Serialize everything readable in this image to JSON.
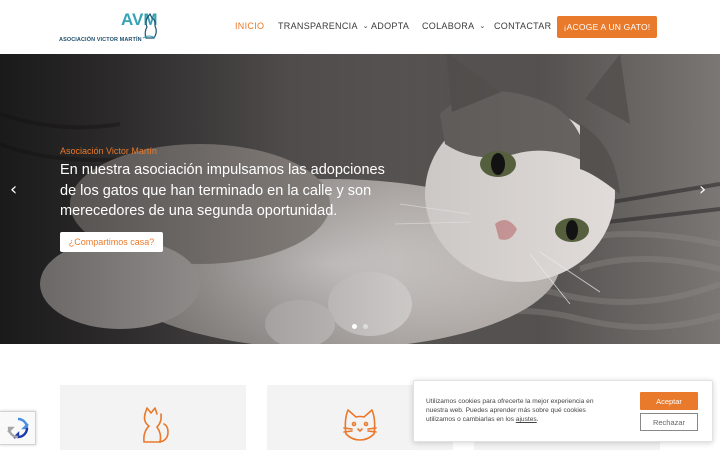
{
  "brand": {
    "logo_letters": "AVM",
    "logo_text": "ASOCIACIÓN VICTOR MARTÍN",
    "colors": {
      "accent": "#e9792b",
      "logo_blue": "#1f4e6b",
      "logo_teal": "#35a3b5"
    }
  },
  "nav": {
    "items": [
      {
        "label": "INICIO",
        "active": true
      },
      {
        "label": "TRANSPARENCIA",
        "dropdown": true
      },
      {
        "label": "ADOPTA"
      },
      {
        "label": "COLABORA",
        "dropdown": true
      },
      {
        "label": "CONTACTAR"
      }
    ],
    "chevron_icon": "chevron-down-icon",
    "cta_label": "¡ACOGE A UN GATO!"
  },
  "hero": {
    "eyebrow": "Asociación Victor Martín",
    "lines": [
      "En nuestra asociación impulsamos las adopciones",
      "de los gatos que han terminado en la calle y son",
      "merecedores de una segunda oportunidad."
    ],
    "button_label": "¿Compartimos casa?",
    "prev_icon": "chevron-left-icon",
    "next_icon": "chevron-right-icon",
    "slide_count": 2,
    "active_slide": 1
  },
  "cards": [
    {
      "icon": "sitting-cat-icon"
    },
    {
      "icon": "cat-face-icon"
    },
    {
      "icon": "paw-icon"
    }
  ],
  "cookie": {
    "text_before_link": "Utilizamos cookies para ofrecerte la mejor experiencia en nuestra web. Puedes aprender más sobre qué cookies utilizamos o cambiarlas en los ",
    "link_label": "ajustes",
    "text_after_link": ".",
    "accept_label": "Aceptar",
    "reject_label": "Rechazar"
  },
  "recaptcha": {
    "icon": "recaptcha-icon"
  }
}
